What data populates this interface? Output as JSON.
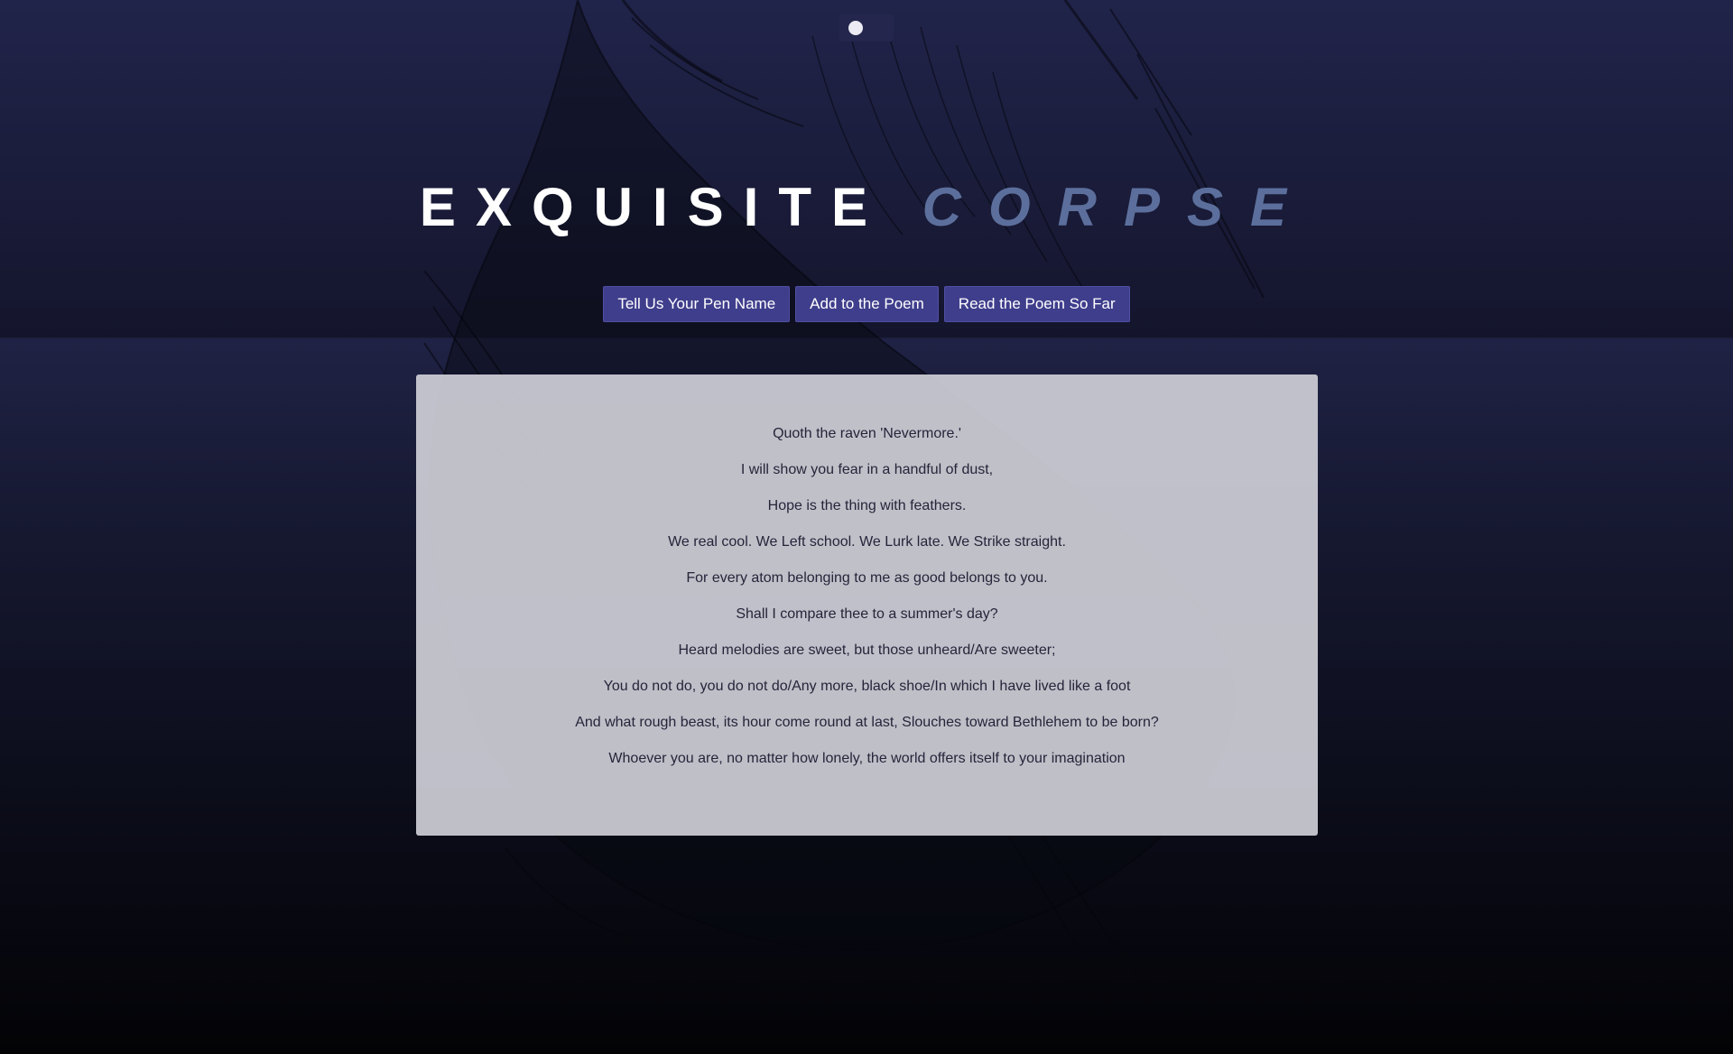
{
  "page": {
    "background_top": "#21244a",
    "background_bottom": "#030306"
  },
  "header": {
    "title_word_1": "EXQUISITE",
    "title_word_2": "CORPSE",
    "title_color_1": "#ffffff",
    "title_color_2": "#5c6f9c"
  },
  "nav": {
    "buttons": [
      {
        "label": "Tell Us Your Pen Name"
      },
      {
        "label": "Add to the Poem"
      },
      {
        "label": "Read the Poem So Far"
      }
    ],
    "button_color": "#3f3e8c"
  },
  "poem": {
    "lines": [
      "Quoth the raven 'Nevermore.'",
      "I will show you fear in a handful of dust,",
      "Hope is the thing with feathers.",
      "We real cool. We Left school. We Lurk late. We Strike straight.",
      "For every atom belonging to me as good belongs to you.",
      "Shall I compare thee to a summer's day?",
      "Heard melodies are sweet, but those unheard/Are sweeter;",
      "You do not do, you do not do/Any more, black shoe/In which I have lived like a foot",
      "And what rough beast, its hour come round at last, Slouches toward Bethlehem to be born?",
      "Whoever you are, no matter how lonely, the world offers itself to your imagination"
    ]
  },
  "icons": {
    "top_toggle": "dot-icon",
    "background": "raven-illustration"
  }
}
